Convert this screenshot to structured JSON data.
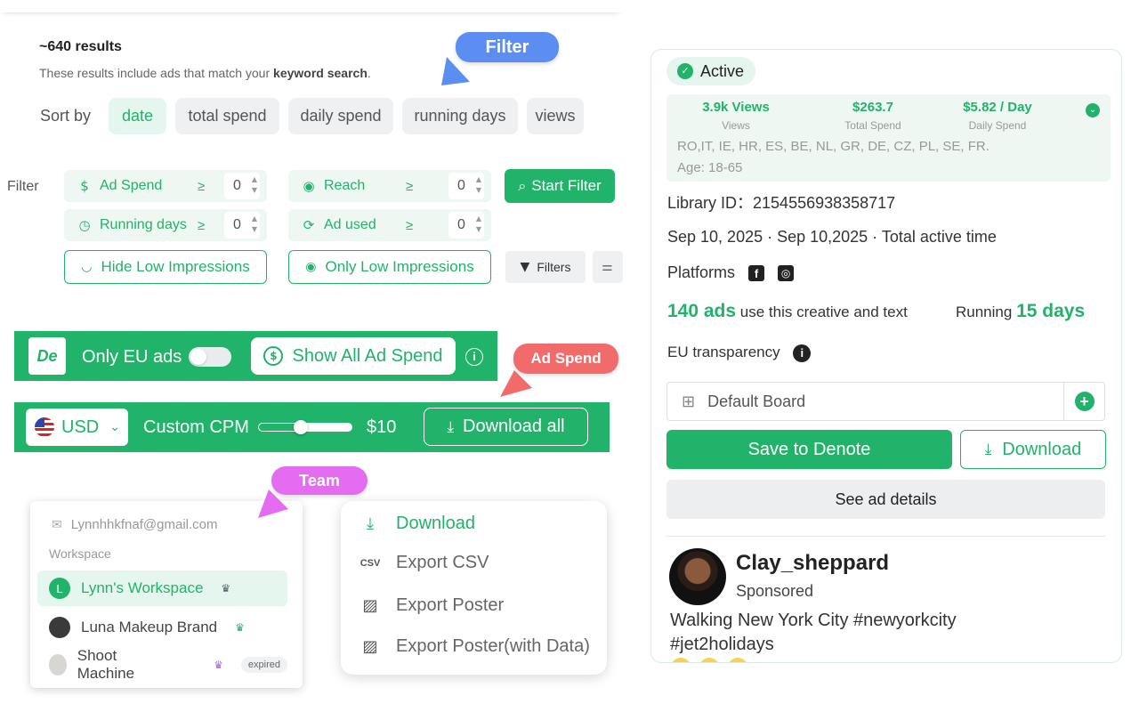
{
  "results": {
    "count": "~640 results",
    "subtitle_prefix": "These results include ads that match your ",
    "subtitle_bold": "keyword search",
    "subtitle_suffix": "."
  },
  "callouts": {
    "filter": "Filter",
    "ad_spend": "Ad Spend",
    "team": "Team"
  },
  "sort": {
    "label": "Sort by",
    "options": [
      "date",
      "total spend",
      "daily spend",
      "running days",
      "views"
    ],
    "active": "date"
  },
  "filter": {
    "label": "Filter",
    "ad_spend": {
      "label": "Ad Spend",
      "op": "≥",
      "value": "0"
    },
    "reach": {
      "label": "Reach",
      "op": "≥",
      "value": "0"
    },
    "running_days": {
      "label": "Running days",
      "op": "≥",
      "value": "0"
    },
    "ad_used": {
      "label": "Ad used",
      "op": "≥",
      "value": "0"
    },
    "start_filter": "Start Filter",
    "hide_low": "Hide Low Impressions",
    "only_low": "Only Low Impressions",
    "filters_btn": "Filters"
  },
  "eu_bar": {
    "logo": "De",
    "only_eu_label": "Only EU ads",
    "only_eu_on": false,
    "show_all_spend": "Show All Ad Spend",
    "info": "i"
  },
  "cpm_bar": {
    "currency": "USD",
    "custom_cpm_label": "Custom CPM",
    "cpm_value": "$10",
    "slider_fraction": 0.45,
    "download_all": "Download all"
  },
  "workspace_menu": {
    "email": "Lynnhhkfnaf@gmail.com",
    "heading": "Workspace",
    "items": [
      {
        "name": "Lynn's Workspace",
        "avatar": "L",
        "selected": true,
        "crown_color": "#555f6d",
        "expired": ""
      },
      {
        "name": "Luna Makeup Brand",
        "avatar": "",
        "selected": false,
        "crown_color": "#21b36a",
        "expired": ""
      },
      {
        "name": "Shoot Machine",
        "avatar": "",
        "selected": false,
        "crown_color": "#a366e8",
        "expired": "expired"
      }
    ]
  },
  "export_menu": {
    "download": "Download",
    "export_csv": "Export CSV",
    "export_poster": "Export Poster",
    "export_poster_data": "Export Poster(with Data)"
  },
  "ad_card": {
    "status": "Active",
    "stats": {
      "views_value": "3.9k Views",
      "views_label": "Views",
      "total_value": "$263.7",
      "total_label": "Total Spend",
      "daily_value": "$5.82 / Day",
      "daily_label": "Daily Spend",
      "countries": "RO,IT, IE, HR, ES, BE, NL, GR, DE, CZ, PL, SE, FR.",
      "age": "Age: 18-65"
    },
    "library_id": "Library ID：2154556938358717",
    "date_range": "Sep 10, 2025 · Sep 10,2025 · Total active time",
    "platforms_label": "Platforms",
    "ads_count": "140 ads",
    "ads_suffix": " use this creative and text",
    "running_label": "Running ",
    "running_days": "15 days",
    "eu_transparency": "EU transparency",
    "board": "Default Board",
    "save_btn": "Save to Denote",
    "download_btn": "Download",
    "details_btn": "See ad details",
    "user_name": "Clay_sheppard",
    "sponsored": "Sponsored",
    "post_line1": "Walking New York City #newyorkcity",
    "post_line2": "#jet2holidays"
  },
  "colors": {
    "brand_green": "#21b36a",
    "light_green": "#e5f6ee",
    "filter_blue": "#5b8ef0",
    "adspend_red": "#f26b6b",
    "team_pink": "#e36cf0"
  }
}
